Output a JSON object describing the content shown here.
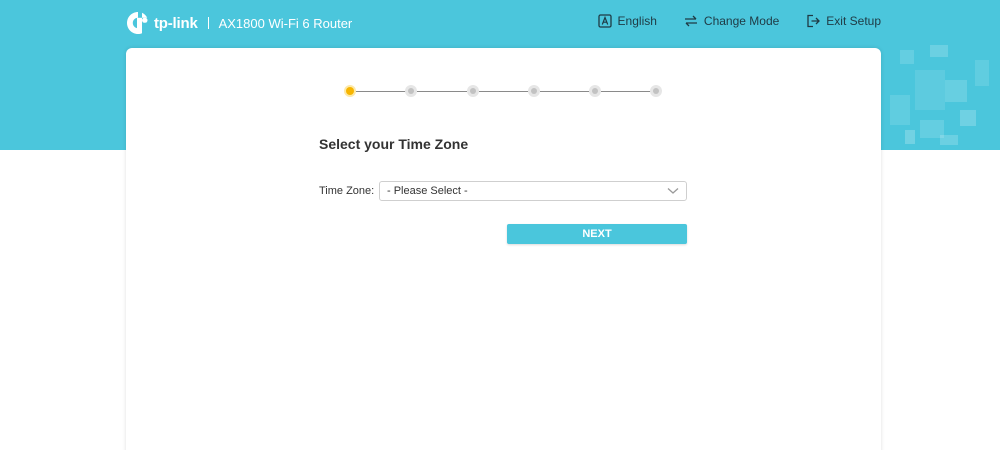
{
  "header": {
    "brand": "tp-link",
    "product": "AX1800 Wi-Fi 6 Router",
    "actions": [
      {
        "label": "English",
        "icon": "language-icon"
      },
      {
        "label": "Change Mode",
        "icon": "change-mode-icon"
      },
      {
        "label": "Exit Setup",
        "icon": "exit-icon"
      }
    ]
  },
  "stepper": {
    "total_steps": 6,
    "current_step": 1
  },
  "main": {
    "title": "Select your Time Zone",
    "time_zone_label": "Time Zone:",
    "time_zone_value": "- Please Select -",
    "next_label": "NEXT"
  },
  "colors": {
    "accent": "#4bc6dc",
    "active_step": "#f7b500"
  }
}
